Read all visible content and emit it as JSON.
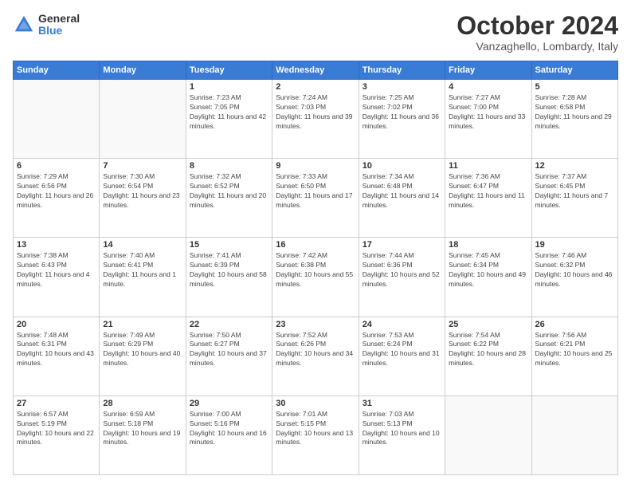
{
  "logo": {
    "general": "General",
    "blue": "Blue"
  },
  "header": {
    "month": "October 2024",
    "location": "Vanzaghello, Lombardy, Italy"
  },
  "days": [
    "Sunday",
    "Monday",
    "Tuesday",
    "Wednesday",
    "Thursday",
    "Friday",
    "Saturday"
  ],
  "weeks": [
    [
      {
        "day": "",
        "info": ""
      },
      {
        "day": "",
        "info": ""
      },
      {
        "day": "1",
        "info": "Sunrise: 7:23 AM\nSunset: 7:05 PM\nDaylight: 11 hours and 42 minutes."
      },
      {
        "day": "2",
        "info": "Sunrise: 7:24 AM\nSunset: 7:03 PM\nDaylight: 11 hours and 39 minutes."
      },
      {
        "day": "3",
        "info": "Sunrise: 7:25 AM\nSunset: 7:02 PM\nDaylight: 11 hours and 36 minutes."
      },
      {
        "day": "4",
        "info": "Sunrise: 7:27 AM\nSunset: 7:00 PM\nDaylight: 11 hours and 33 minutes."
      },
      {
        "day": "5",
        "info": "Sunrise: 7:28 AM\nSunset: 6:58 PM\nDaylight: 11 hours and 29 minutes."
      }
    ],
    [
      {
        "day": "6",
        "info": "Sunrise: 7:29 AM\nSunset: 6:56 PM\nDaylight: 11 hours and 26 minutes."
      },
      {
        "day": "7",
        "info": "Sunrise: 7:30 AM\nSunset: 6:54 PM\nDaylight: 11 hours and 23 minutes."
      },
      {
        "day": "8",
        "info": "Sunrise: 7:32 AM\nSunset: 6:52 PM\nDaylight: 11 hours and 20 minutes."
      },
      {
        "day": "9",
        "info": "Sunrise: 7:33 AM\nSunset: 6:50 PM\nDaylight: 11 hours and 17 minutes."
      },
      {
        "day": "10",
        "info": "Sunrise: 7:34 AM\nSunset: 6:48 PM\nDaylight: 11 hours and 14 minutes."
      },
      {
        "day": "11",
        "info": "Sunrise: 7:36 AM\nSunset: 6:47 PM\nDaylight: 11 hours and 11 minutes."
      },
      {
        "day": "12",
        "info": "Sunrise: 7:37 AM\nSunset: 6:45 PM\nDaylight: 11 hours and 7 minutes."
      }
    ],
    [
      {
        "day": "13",
        "info": "Sunrise: 7:38 AM\nSunset: 6:43 PM\nDaylight: 11 hours and 4 minutes."
      },
      {
        "day": "14",
        "info": "Sunrise: 7:40 AM\nSunset: 6:41 PM\nDaylight: 11 hours and 1 minute."
      },
      {
        "day": "15",
        "info": "Sunrise: 7:41 AM\nSunset: 6:39 PM\nDaylight: 10 hours and 58 minutes."
      },
      {
        "day": "16",
        "info": "Sunrise: 7:42 AM\nSunset: 6:38 PM\nDaylight: 10 hours and 55 minutes."
      },
      {
        "day": "17",
        "info": "Sunrise: 7:44 AM\nSunset: 6:36 PM\nDaylight: 10 hours and 52 minutes."
      },
      {
        "day": "18",
        "info": "Sunrise: 7:45 AM\nSunset: 6:34 PM\nDaylight: 10 hours and 49 minutes."
      },
      {
        "day": "19",
        "info": "Sunrise: 7:46 AM\nSunset: 6:32 PM\nDaylight: 10 hours and 46 minutes."
      }
    ],
    [
      {
        "day": "20",
        "info": "Sunrise: 7:48 AM\nSunset: 6:31 PM\nDaylight: 10 hours and 43 minutes."
      },
      {
        "day": "21",
        "info": "Sunrise: 7:49 AM\nSunset: 6:29 PM\nDaylight: 10 hours and 40 minutes."
      },
      {
        "day": "22",
        "info": "Sunrise: 7:50 AM\nSunset: 6:27 PM\nDaylight: 10 hours and 37 minutes."
      },
      {
        "day": "23",
        "info": "Sunrise: 7:52 AM\nSunset: 6:26 PM\nDaylight: 10 hours and 34 minutes."
      },
      {
        "day": "24",
        "info": "Sunrise: 7:53 AM\nSunset: 6:24 PM\nDaylight: 10 hours and 31 minutes."
      },
      {
        "day": "25",
        "info": "Sunrise: 7:54 AM\nSunset: 6:22 PM\nDaylight: 10 hours and 28 minutes."
      },
      {
        "day": "26",
        "info": "Sunrise: 7:56 AM\nSunset: 6:21 PM\nDaylight: 10 hours and 25 minutes."
      }
    ],
    [
      {
        "day": "27",
        "info": "Sunrise: 6:57 AM\nSunset: 5:19 PM\nDaylight: 10 hours and 22 minutes."
      },
      {
        "day": "28",
        "info": "Sunrise: 6:59 AM\nSunset: 5:18 PM\nDaylight: 10 hours and 19 minutes."
      },
      {
        "day": "29",
        "info": "Sunrise: 7:00 AM\nSunset: 5:16 PM\nDaylight: 10 hours and 16 minutes."
      },
      {
        "day": "30",
        "info": "Sunrise: 7:01 AM\nSunset: 5:15 PM\nDaylight: 10 hours and 13 minutes."
      },
      {
        "day": "31",
        "info": "Sunrise: 7:03 AM\nSunset: 5:13 PM\nDaylight: 10 hours and 10 minutes."
      },
      {
        "day": "",
        "info": ""
      },
      {
        "day": "",
        "info": ""
      }
    ]
  ]
}
